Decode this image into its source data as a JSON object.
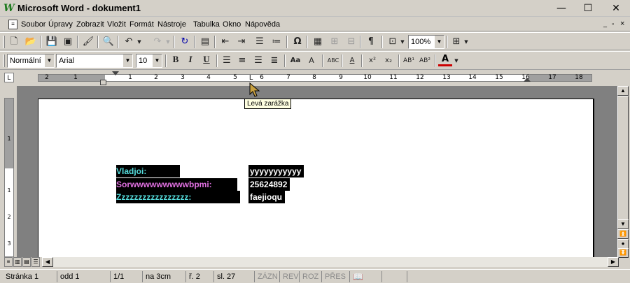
{
  "window": {
    "title": "Microsoft Word - dokument1",
    "app_icon": "W",
    "minimize": "—",
    "maximize": "☐",
    "close": "✕"
  },
  "menu": {
    "items": [
      {
        "label": "Soubor"
      },
      {
        "label": "Úpravy"
      },
      {
        "label": "Zobrazit"
      },
      {
        "label": "Vložit"
      },
      {
        "label": "Formát"
      },
      {
        "label": "Nástroje"
      },
      {
        "label": "Tabulka"
      },
      {
        "label": "Okno"
      },
      {
        "label": "Nápověda"
      }
    ],
    "doc_min": "_",
    "doc_restore": "▫",
    "doc_close": "×"
  },
  "standard_toolbar": {
    "zoom": "100%"
  },
  "format_toolbar": {
    "style": "Normální",
    "font": "Arial",
    "size": "10",
    "bold": "B",
    "italic": "I",
    "underline": "U"
  },
  "ruler": {
    "labels": [
      "2",
      "1",
      "1",
      "2",
      "3",
      "4",
      "5",
      "6",
      "7",
      "8",
      "9",
      "10",
      "11",
      "12",
      "13",
      "14",
      "15",
      "16",
      "17",
      "18"
    ],
    "v_labels": [
      "1",
      "1",
      "2",
      "3"
    ],
    "tab_selector": "L"
  },
  "tooltip": "Levá zarážka",
  "document": {
    "rows": [
      {
        "label": "Vladjoi:",
        "value": "yyyyyyyyyyy",
        "label_color": "#55dddd"
      },
      {
        "label": "Sorwwwwwwwwwbpmi:",
        "value": "25624892",
        "label_color": "#e070e0"
      },
      {
        "label": "Zzzzzzzzzzzzzzzzz:",
        "value": "faejioqu",
        "label_color": "#55dddd"
      }
    ]
  },
  "status": {
    "page": "Stránka  1",
    "section": "odd  1",
    "pages": "1/1",
    "at": "na  3cm",
    "line": "ř.  2",
    "col": "sl.  27",
    "rec": "ZÁZN",
    "rev": "REV",
    "ext": "ROZ",
    "ovr": "PŘES"
  },
  "colors": {
    "accent_blue": "#0000aa",
    "cursor_gold": "#c8a040"
  }
}
